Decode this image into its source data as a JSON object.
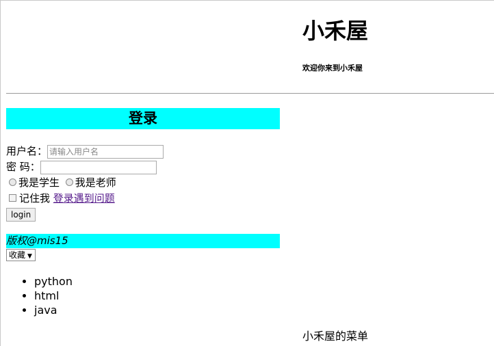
{
  "header": {
    "title": "小禾屋",
    "subtitle": "欢迎你来到小禾屋"
  },
  "login": {
    "heading": "登录",
    "username_label": "用户名：",
    "username_placeholder": "请输入用户名",
    "username_value": "",
    "password_label": "密 码：",
    "password_value": "",
    "role_student": "我是学生",
    "role_teacher": "我是老师",
    "remember_label": "记住我",
    "help_link": "登录遇到问题",
    "submit_label": "login"
  },
  "footer": {
    "copyright": "版权@mis15"
  },
  "collect": {
    "selected": "收藏",
    "arrow_icon": "triangle-down"
  },
  "languages": [
    "python",
    "html",
    "java"
  ],
  "menu_caption": "小禾屋的菜单",
  "colors": {
    "highlight": "#00ffff",
    "visited_link": "#551a8b"
  }
}
